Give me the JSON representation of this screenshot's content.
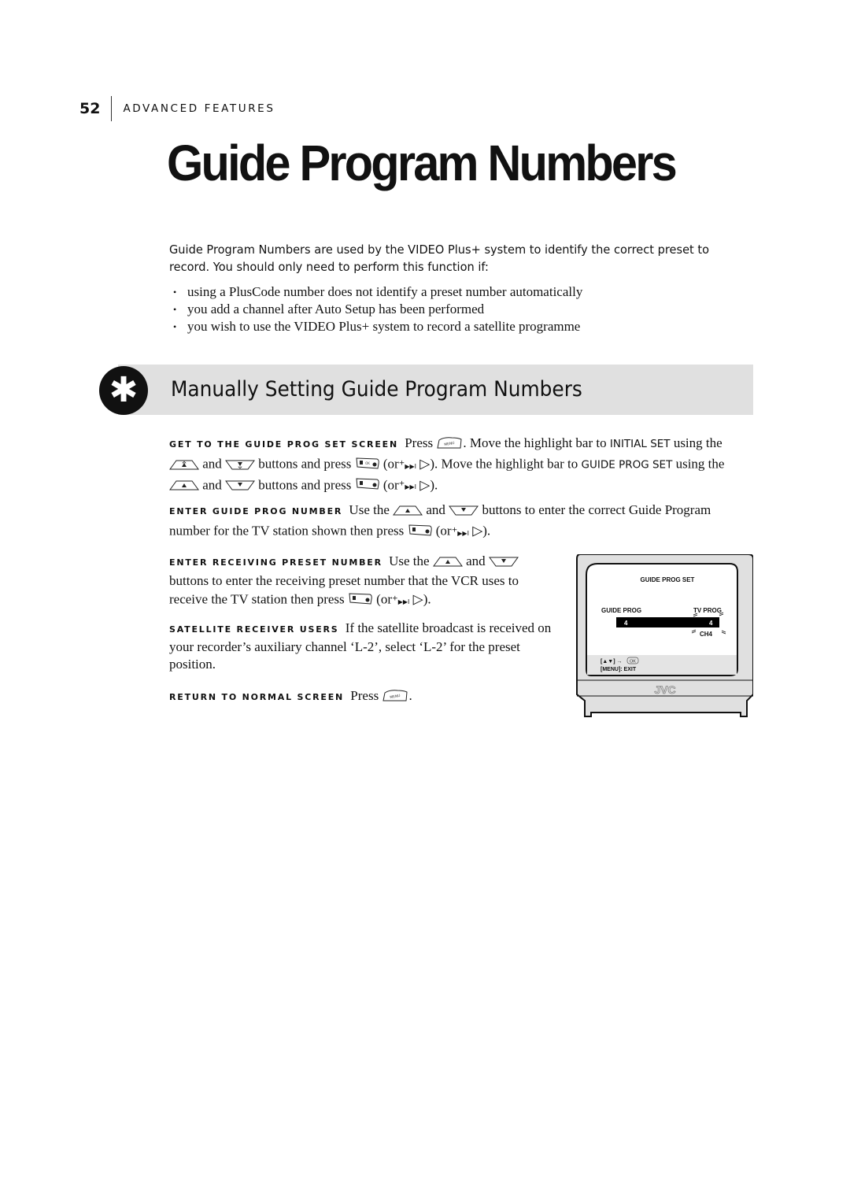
{
  "header": {
    "page_number": "52",
    "section": "ADVANCED FEATURES"
  },
  "title": "Guide Program Numbers",
  "intro": {
    "paragraph": "Guide Program Numbers are used by the VIDEO Plus+ system to identify the correct preset to record. You should only need to perform this function if:",
    "bullets": [
      "using a PlusCode number does not identify a preset number automatically",
      "you add a channel after Auto Setup has been performed",
      "you wish to use the VIDEO Plus+ system to record a satellite programme"
    ]
  },
  "section": {
    "icon": "asterisk-icon",
    "icon_glyph": "✱",
    "title": "Manually Setting Guide Program Numbers"
  },
  "steps": [
    {
      "lead": "GET TO THE GUIDE PROG SET SCREEN",
      "t1": "Press",
      "t2": ". Move the highlight bar to",
      "kw1": "INITIAL SET",
      "t3": "using the",
      "t4": "and",
      "t5": "buttons and press",
      "t6": "(or",
      "t7": "). Move the highlight bar to",
      "kw2": "GUIDE PROG SET",
      "t8": "using the",
      "t9": "and",
      "t10": "buttons and press",
      "t11": "(or",
      "t12": ")."
    },
    {
      "lead": "ENTER GUIDE PROG NUMBER",
      "t1": "Use the",
      "t2": "and",
      "t3": "buttons to enter the correct Guide Program number for the TV station shown then press",
      "t4": "(or",
      "t5": ")."
    },
    {
      "lead": "ENTER RECEIVING PRESET NUMBER",
      "t1": "Use the",
      "t2": "and",
      "t3": "buttons to enter the receiving preset number that the VCR uses to receive the TV station then press",
      "t4": "(or",
      "t5": ")."
    },
    {
      "lead": "SATELLITE RECEIVER USERS",
      "text": "If the satellite broadcast is received on your recorder’s auxiliary channel ‘L-2’,  select ‘L-2’ for the preset position."
    },
    {
      "lead": "RETURN TO NORMAL SCREEN",
      "t1": "Press",
      "t2": "."
    }
  ],
  "buttons": {
    "menu": "MENU",
    "ok": "OK",
    "skip_plus": "+",
    "skip_glyph": "▶▶I",
    "play_glyph": "▷"
  },
  "tv_screen": {
    "heading": "GUIDE PROG SET",
    "col_left": "GUIDE PROG",
    "col_right": "TV PROG",
    "guide_prog_value": "4",
    "tv_prog_value": "4",
    "channel": "CH4",
    "hint_line1": "[▲▼] →",
    "hint_ok": "OK",
    "hint_line2": "[MENU]: EXIT",
    "brand": "JVC"
  }
}
